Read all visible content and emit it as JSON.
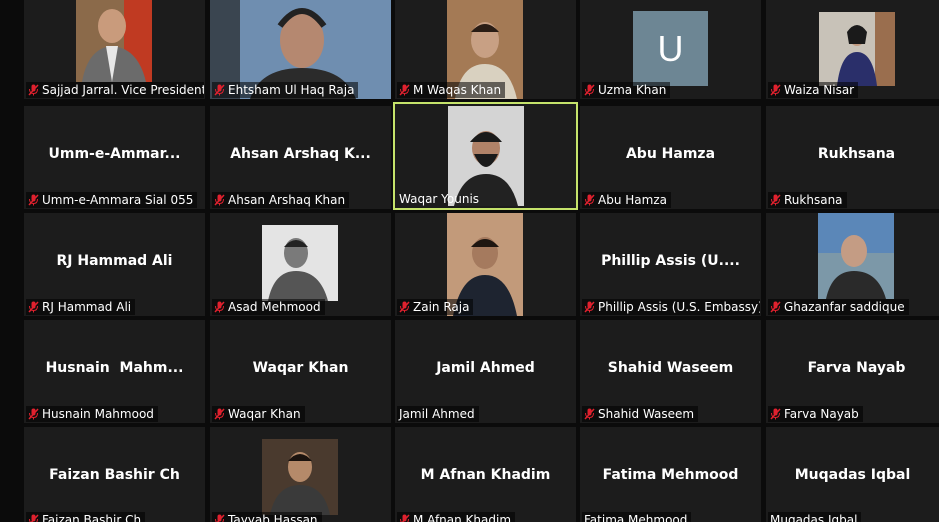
{
  "participants": [
    {
      "name": "Sajjad Jarral. Vice President...",
      "muted": true
    },
    {
      "name": "Ehtsham Ul Haq Raja",
      "muted": true
    },
    {
      "name": "M Waqas Khan",
      "muted": true
    },
    {
      "name": "Uzma Khan",
      "muted": true,
      "avatar_letter": "U"
    },
    {
      "name": "Waiza Nisar",
      "muted": true
    },
    {
      "name": "Umm-e-Ammara Sial 055",
      "display": "Umm-e-Ammar...",
      "muted": true
    },
    {
      "name": "Ahsan Arshaq Khan",
      "display": "Ahsan Arshaq K...",
      "muted": true
    },
    {
      "name": "Waqar Younis",
      "muted": false,
      "speaking": true
    },
    {
      "name": "Abu Hamza",
      "display": "Abu Hamza",
      "muted": true
    },
    {
      "name": "Rukhsana",
      "display": "Rukhsana",
      "muted": true
    },
    {
      "name": "RJ Hammad Ali",
      "display": "RJ Hammad Ali",
      "muted": true
    },
    {
      "name": "Asad Mehmood",
      "muted": true
    },
    {
      "name": "Zain Raja",
      "muted": true
    },
    {
      "name": "Phillip Assis (U.S. Embassy)",
      "display": "Phillip Assis (U....",
      "muted": true
    },
    {
      "name": "Ghazanfar saddique",
      "muted": true
    },
    {
      "name": "Husnain Mahmood",
      "display": "Husnain  Mahm...",
      "muted": true
    },
    {
      "name": "Waqar Khan",
      "display": "Waqar Khan",
      "muted": true
    },
    {
      "name": "Jamil Ahmed",
      "display": "Jamil Ahmed",
      "muted": false
    },
    {
      "name": "Shahid Waseem",
      "display": "Shahid Waseem",
      "muted": true
    },
    {
      "name": "Farva Nayab",
      "display": "Farva Nayab",
      "muted": true
    },
    {
      "name": "Faizan Bashir Ch",
      "display": "Faizan Bashir Ch",
      "muted": true
    },
    {
      "name": "Tayyab Hassan",
      "muted": true
    },
    {
      "name": "M Afnan Khadim",
      "display": "M Afnan Khadim",
      "muted": true
    },
    {
      "name": "Fatima Mehmood",
      "display": "Fatima Mehmood",
      "muted": false
    },
    {
      "name": "Muqadas Iqbal",
      "display": "Muqadas Iqbal",
      "muted": false
    }
  ],
  "colors": {
    "background": "#0b0b0b",
    "tile": "#1c1c1c",
    "active_speaker_border": "#c5e36b",
    "muted_icon": "#e0212e"
  }
}
